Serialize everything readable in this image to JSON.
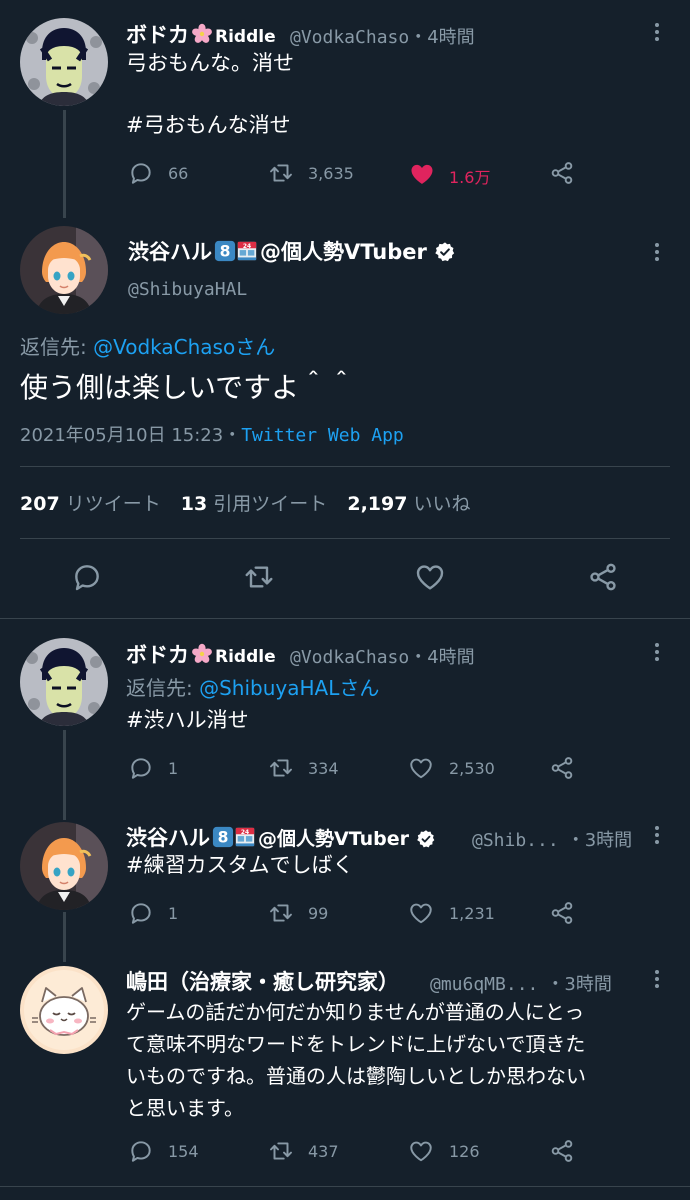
{
  "tweet1": {
    "name": "ボドカ",
    "name_suffix": "Riddle",
    "handle": "@VodkaChaso",
    "time": "・4時間",
    "text": "弓おもんな。消せ",
    "hashtag": "#弓おもんな消せ",
    "replies": "66",
    "retweets": "3,635",
    "likes": "1.6万",
    "liked": true
  },
  "main": {
    "name": "渋谷ハル",
    "name_suffix": "@個人勢VTuber",
    "handle": "@ShibuyaHAL",
    "reply_prefix": "返信先: ",
    "reply_to": "@VodkaChasoさん",
    "text": "使う側は楽しいですよ＾＾",
    "date": "2021年05月10日 15:23・",
    "source": "Twitter Web App",
    "stats": {
      "retweets_num": "207",
      "retweets_label": "リツイート",
      "quotes_num": "13",
      "quotes_label": "引用ツイート",
      "likes_num": "2,197",
      "likes_label": "いいね"
    }
  },
  "reply1": {
    "name": "ボドカ",
    "name_suffix": "Riddle",
    "handle": "@VodkaChaso",
    "time": "・4時間",
    "reply_prefix": "返信先: ",
    "reply_to": "@ShibuyaHALさん",
    "hashtag": "#渋ハル消せ",
    "replies": "1",
    "retweets": "334",
    "likes": "2,530"
  },
  "reply2": {
    "name": "渋谷ハル",
    "name_suffix": "@個人勢VTuber",
    "handle": "@Shib...",
    "time": "・3時間",
    "hashtag": "#練習カスタムでしばく",
    "replies": "1",
    "retweets": "99",
    "likes": "1,231"
  },
  "reply3": {
    "name": "嶋田（治療家・癒し研究家）",
    "handle": "@mu6qMB...",
    "time": "・3時間",
    "lines": [
      "ゲームの話だか何だか知りませんが普通の人にとっ",
      "て意味不明なワードをトレンドに上げないで頂きた",
      "いものですね。普通の人は鬱陶しいとしか思わない",
      "と思います。"
    ],
    "replies": "154",
    "retweets": "437",
    "likes": "126"
  },
  "colors": {
    "background": "#15202b",
    "link": "#1da1f2",
    "muted": "#8899a6",
    "like": "#e0245e"
  }
}
